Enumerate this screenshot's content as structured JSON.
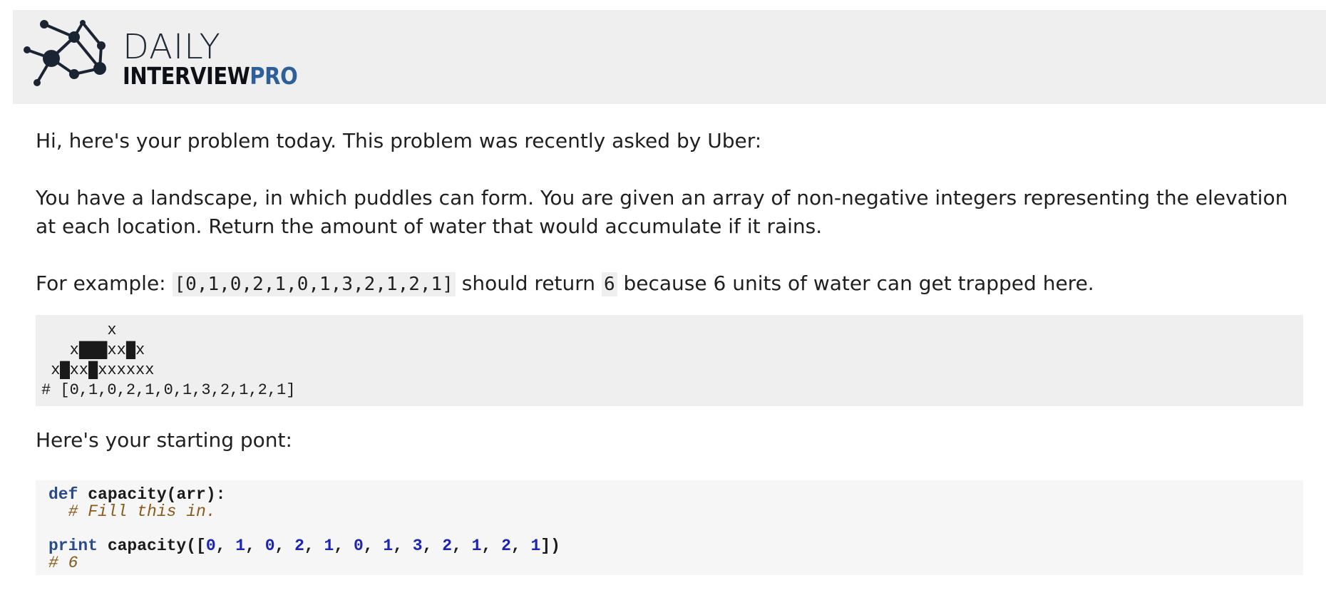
{
  "header": {
    "logo_top": "DAILY",
    "logo_bottom_dark": "INTERVIEW",
    "logo_bottom_accent": "PRO",
    "logo_icon": "network-nodes-icon",
    "accent_color": "#2f5f99"
  },
  "body": {
    "intro": "Hi, here's your problem today. This problem was recently asked by Uber:",
    "problem": "You have a landscape, in which puddles can form. You are given an array of non-negative integers representing the elevation at each location. Return the amount of water that would accumulate if it rains.",
    "example_prefix": "For example: ",
    "example_array": "[0,1,0,2,1,0,1,3,2,1,2,1]",
    "example_middle": " should return ",
    "example_result": "6",
    "example_suffix": " because 6 units of water can get trapped here.",
    "starting_point": "Here's your starting pont:"
  },
  "diagram": {
    "comment_line": "# [0,1,0,2,1,0,1,3,2,1,2,1]",
    "elevation": [
      0,
      1,
      0,
      2,
      1,
      0,
      1,
      3,
      2,
      1,
      2,
      1
    ],
    "land_char": "x"
  },
  "code": {
    "def_kw": "def",
    "signature": " capacity(arr):",
    "fill_comment": "# Fill this in.",
    "print_kw": "print",
    "call_open": " capacity([",
    "args": [
      "0",
      "1",
      "0",
      "2",
      "1",
      "0",
      "1",
      "3",
      "2",
      "1",
      "2",
      "1"
    ],
    "call_close": "])",
    "result_comment": "# 6"
  }
}
